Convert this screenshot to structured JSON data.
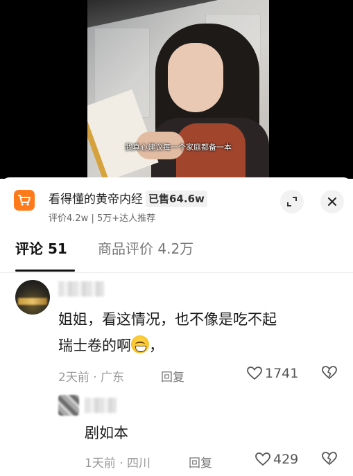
{
  "video": {
    "subtitle": "我真心建议每一个家庭都备一本"
  },
  "product": {
    "title": "看得懂的黄帝内经",
    "sold": "已售64.6w",
    "subline": "评价4.2w | 5万+达人推荐",
    "icon": "shopping-cart-icon",
    "accent": "#ff7a1a"
  },
  "tabs": [
    {
      "label": "评论 51",
      "active": true
    },
    {
      "label": "商品评价 4.2万",
      "active": false
    }
  ],
  "comments": [
    {
      "text_line1": "姐姐，看这情况，也不像是吃不起",
      "text_line2": "瑞士卷的啊",
      "text_suffix": "，",
      "time_location": "2天前 · 广东",
      "reply_label": "回复",
      "likes": "1741"
    }
  ],
  "replies": [
    {
      "text": "剧如本",
      "time_location": "1天前 · 四川",
      "reply_label": "回复",
      "likes": "429"
    }
  ]
}
